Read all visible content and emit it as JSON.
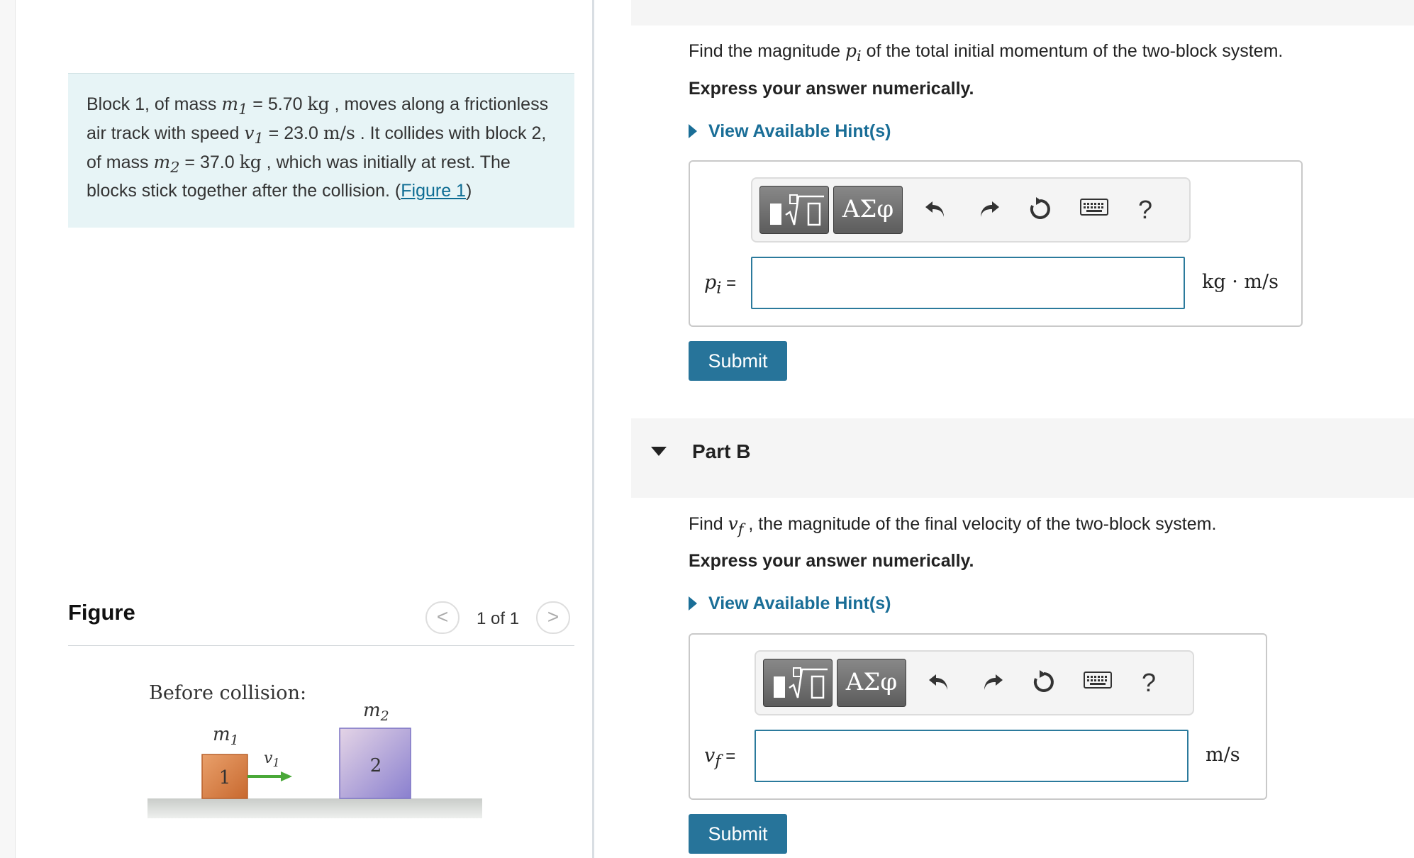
{
  "problem": {
    "s1": "Block 1, of mass ",
    "m1_sym": "m",
    "m1_sub": "1",
    "m1_eq": " = 5.70 ",
    "m1_unit": "kg",
    "s2": " , moves along a frictionless air track with speed ",
    "v1_sym": "v",
    "v1_sub": "1",
    "v1_eq": " = 23.0 ",
    "v1_unit": "m/s",
    "s3": " . It collides with block 2, of mass ",
    "m2_sym": "m",
    "m2_sub": "2",
    "m2_eq": " = 37.0 ",
    "m2_unit": "kg",
    "s4": " , which was initially at rest. The blocks stick together after the collision. (",
    "figure_link": "Figure 1",
    "s5": ")"
  },
  "figure": {
    "title": "Figure",
    "pager_prev": "<",
    "pager_text": "1 of 1",
    "pager_next": ">",
    "caption": "Before collision:",
    "m1_label": "m",
    "m1_sub": "1",
    "m2_label": "m",
    "m2_sub": "2",
    "v1_label": "v",
    "v1_sub": "1",
    "block1_text": "1",
    "block2_text": "2"
  },
  "partA": {
    "q_pre": "Find the magnitude ",
    "q_sym": "p",
    "q_sub": "i",
    "q_post": " of the total initial momentum of the two-block system.",
    "instruction": "Express your answer numerically.",
    "hint": "View Available Hint(s)",
    "toolbar_greek": "ΑΣφ",
    "toolbar_help": "?",
    "lhs_sym": "p",
    "lhs_sub": "i",
    "lhs_eq": " =",
    "input_value": "",
    "unit": "kg · m/s",
    "submit": "Submit"
  },
  "partB": {
    "header": "Part B",
    "q_pre": "Find ",
    "q_sym": "v",
    "q_sub": "f",
    "q_post": " , the magnitude of the final velocity of the two-block system.",
    "instruction": "Express your answer numerically.",
    "hint": "View Available Hint(s)",
    "toolbar_greek": "ΑΣφ",
    "toolbar_help": "?",
    "lhs_sym": "v",
    "lhs_sub": "f",
    "lhs_eq": " =",
    "input_value": "",
    "unit": "m/s",
    "submit": "Submit"
  },
  "colors": {
    "accent": "#27749a",
    "link": "#1a6e97",
    "problem_bg": "#e7f4f6",
    "block1": "#d9824a",
    "block2": "#b7a7d6",
    "arrow": "#49a838"
  }
}
